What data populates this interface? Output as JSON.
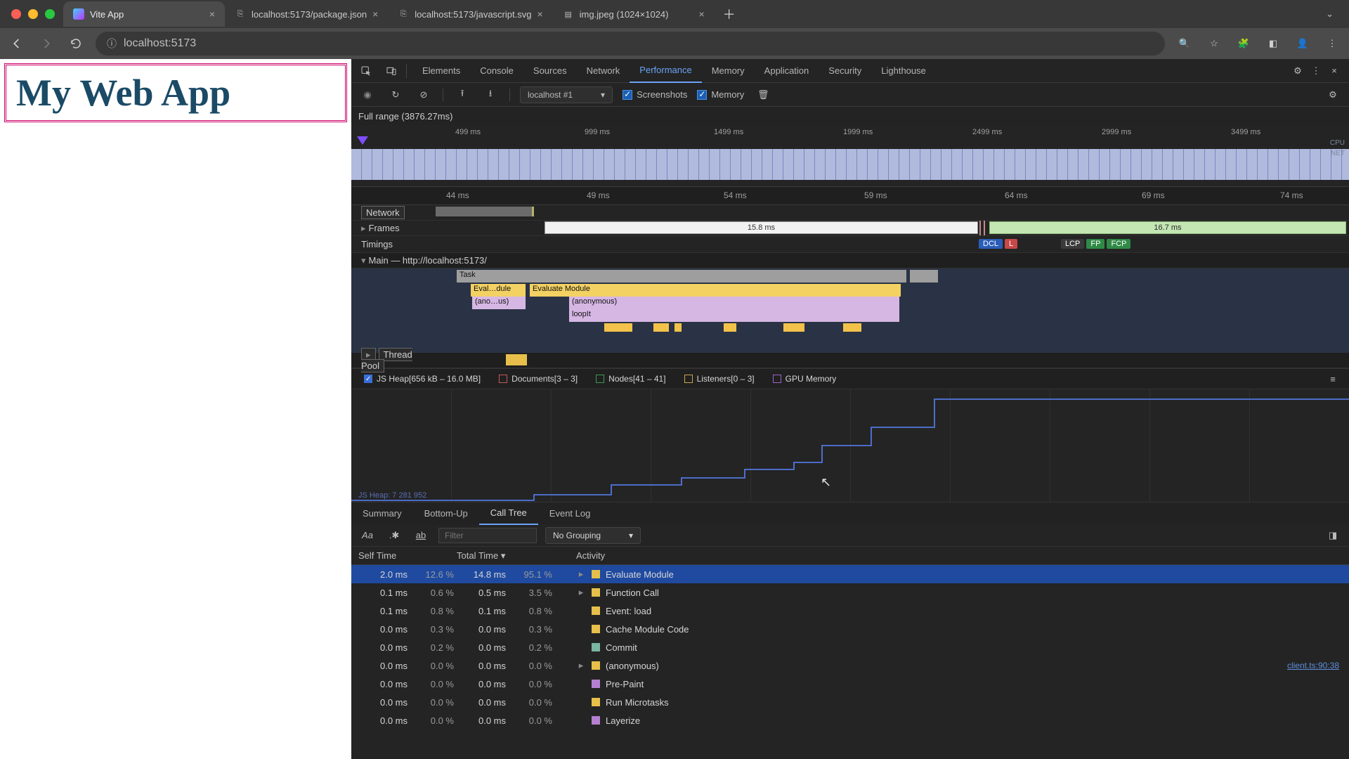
{
  "window": {
    "tabs": [
      {
        "title": "Vite App",
        "active": true
      },
      {
        "title": "localhost:5173/package.json",
        "active": false
      },
      {
        "title": "localhost:5173/javascript.svg",
        "active": false
      },
      {
        "title": "img.jpeg (1024×1024)",
        "active": false
      }
    ],
    "url": "localhost:5173"
  },
  "page": {
    "heading": "My Web App"
  },
  "devtools": {
    "panels": [
      "Elements",
      "Console",
      "Sources",
      "Network",
      "Performance",
      "Memory",
      "Application",
      "Security",
      "Lighthouse"
    ],
    "active_panel": "Performance",
    "recording_select": "localhost #1",
    "checks": {
      "screenshots": "Screenshots",
      "memory": "Memory"
    },
    "range_label": "Full range (3876.27ms)",
    "overview_ticks": [
      "499 ms",
      "999 ms",
      "1499 ms",
      "1999 ms",
      "2499 ms",
      "2999 ms",
      "3499 ms"
    ],
    "overview_side": [
      "CPU",
      "NET"
    ],
    "zoom_ticks": [
      "44 ms",
      "49 ms",
      "54 ms",
      "59 ms",
      "64 ms",
      "69 ms",
      "74 ms"
    ],
    "tracks": {
      "network": "Network",
      "frames": "Frames",
      "timings": "Timings",
      "main": "Main — http://localhost:5173/",
      "thread": "Thread Pool"
    },
    "frames": {
      "f1": "15.8 ms",
      "f2": "16.7 ms"
    },
    "timings_badges": {
      "dcl": "DCL",
      "l": "L",
      "lcp": "LCP",
      "fp": "FP",
      "fcp": "FCP"
    },
    "flame": {
      "task": "Task",
      "eval1": "Eval…dule",
      "eval2": "Evaluate Module",
      "anon1": "(ano…us)",
      "anon2": "(anonymous)",
      "loop": "loopIt"
    },
    "mem_legend": {
      "js": "JS Heap[656 kB – 16.0 MB]",
      "doc": "Documents[3 – 3]",
      "nod": "Nodes[41 – 41]",
      "lis": "Listeners[0 – 3]",
      "gpu": "GPU Memory"
    },
    "mem_heap_label": "JS Heap: 7 281 952",
    "bottom_tabs": [
      "Summary",
      "Bottom-Up",
      "Call Tree",
      "Event Log"
    ],
    "bottom_active": "Call Tree",
    "filter_placeholder": "Filter",
    "grouping": "No Grouping",
    "table_head": {
      "self": "Self Time",
      "total": "Total Time",
      "act": "Activity"
    },
    "rows": [
      {
        "self_ms": "2.0 ms",
        "self_pct": "12.6 %",
        "tot_ms": "14.8 ms",
        "tot_pct": "95.1 %",
        "expand": true,
        "sw": "y",
        "name": "Evaluate Module",
        "sel": true
      },
      {
        "self_ms": "0.1 ms",
        "self_pct": "0.6 %",
        "tot_ms": "0.5 ms",
        "tot_pct": "3.5 %",
        "expand": true,
        "sw": "y",
        "name": "Function Call"
      },
      {
        "self_ms": "0.1 ms",
        "self_pct": "0.8 %",
        "tot_ms": "0.1 ms",
        "tot_pct": "0.8 %",
        "expand": false,
        "sw": "y",
        "name": "Event: load"
      },
      {
        "self_ms": "0.0 ms",
        "self_pct": "0.3 %",
        "tot_ms": "0.0 ms",
        "tot_pct": "0.3 %",
        "expand": false,
        "sw": "y",
        "name": "Cache Module Code"
      },
      {
        "self_ms": "0.0 ms",
        "self_pct": "0.2 %",
        "tot_ms": "0.0 ms",
        "tot_pct": "0.2 %",
        "expand": false,
        "sw": "b",
        "name": "Commit"
      },
      {
        "self_ms": "0.0 ms",
        "self_pct": "0.0 %",
        "tot_ms": "0.0 ms",
        "tot_pct": "0.0 %",
        "expand": true,
        "sw": "y",
        "name": "(anonymous)",
        "link": "client.ts:90:38"
      },
      {
        "self_ms": "0.0 ms",
        "self_pct": "0.0 %",
        "tot_ms": "0.0 ms",
        "tot_pct": "0.0 %",
        "expand": false,
        "sw": "p",
        "name": "Pre-Paint"
      },
      {
        "self_ms": "0.0 ms",
        "self_pct": "0.0 %",
        "tot_ms": "0.0 ms",
        "tot_pct": "0.0 %",
        "expand": false,
        "sw": "y",
        "name": "Run Microtasks"
      },
      {
        "self_ms": "0.0 ms",
        "self_pct": "0.0 %",
        "tot_ms": "0.0 ms",
        "tot_pct": "0.0 %",
        "expand": false,
        "sw": "p",
        "name": "Layerize"
      }
    ]
  }
}
